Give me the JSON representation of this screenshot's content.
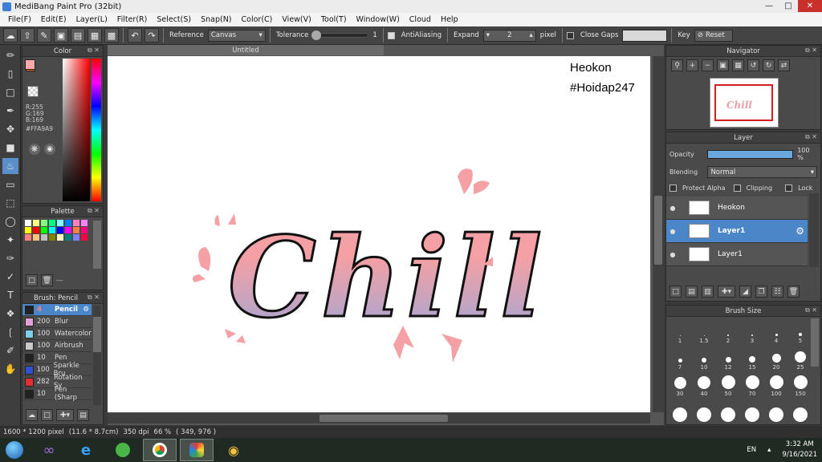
{
  "window": {
    "title": "MediBang Paint Pro (32bit)"
  },
  "menu": [
    "File(F)",
    "Edit(E)",
    "Layer(L)",
    "Filter(R)",
    "Select(S)",
    "Snap(N)",
    "Color(C)",
    "View(V)",
    "Tool(T)",
    "Window(W)",
    "Cloud",
    "Help"
  ],
  "toolbar": {
    "reference_label": "Reference",
    "reference_value": "Canvas",
    "tolerance_label": "Tolerance",
    "tolerance_value": "1",
    "antialiasing_label": "AntiAliasing",
    "expand_label": "Expand",
    "expand_value": "2",
    "expand_unit": "pixel",
    "close_gaps_label": "Close Gaps",
    "key_label": "Key",
    "reset_label": "Reset"
  },
  "color_panel": {
    "title": "Color",
    "r": "R:255",
    "g": "G:169",
    "b": "B:169",
    "hex": "#FFA9A9",
    "primary": "#FFA9A9",
    "secondary": "#FF6A00"
  },
  "palette_panel": {
    "title": "Palette",
    "swatches": [
      "#ffffff",
      "#ffff80",
      "#80ff80",
      "#00ff80",
      "#80ffff",
      "#0080ff",
      "#ff80c0",
      "#ff80ff",
      "#ffff00",
      "#ff0000",
      "#00ff00",
      "#00ffff",
      "#0000ff",
      "#ff00ff",
      "#ff8040",
      "#ff0080",
      "#ff8080",
      "#ffc080",
      "#c0c0c0",
      "#808000",
      "#ffffc0",
      "#008080",
      "#8080ff",
      "#ff0040"
    ],
    "dash": "---"
  },
  "brush_panel": {
    "title": "Brush: Pencil",
    "items": [
      {
        "size": "4",
        "name": "Pencil",
        "color": "#222"
      },
      {
        "size": "200",
        "name": "Blur",
        "color": "#e2a0d8"
      },
      {
        "size": "100",
        "name": "Watercolor",
        "color": "#7cd0e8"
      },
      {
        "size": "100",
        "name": "Airbrush",
        "color": "#c8c8c8"
      },
      {
        "size": "10",
        "name": "Pen",
        "color": "#222"
      },
      {
        "size": "100",
        "name": "Sparkle Bru",
        "color": "#3050d0"
      },
      {
        "size": "282",
        "name": "Rotation Sy",
        "color": "#e03030"
      },
      {
        "size": "10",
        "name": "Pen (Sharp",
        "color": "#222"
      }
    ]
  },
  "canvas": {
    "tab": "Untitled",
    "watermark_line1": "Heokon",
    "watermark_line2": "#Hoidap247",
    "artwork_text": "Chill"
  },
  "navigator": {
    "title": "Navigator"
  },
  "layer_panel": {
    "title": "Layer",
    "opacity_label": "Opacity",
    "opacity_value": "100 %",
    "opacity_fraction": 1.0,
    "blending_label": "Blending",
    "blending_value": "Normal",
    "protect_alpha": "Protect Alpha",
    "clipping": "Clipping",
    "lock": "Lock",
    "layers": [
      {
        "name": "Heokon",
        "selected": false
      },
      {
        "name": "Layer1",
        "selected": true
      },
      {
        "name": "Layer1",
        "selected": false
      }
    ]
  },
  "brush_size_panel": {
    "title": "Brush Size",
    "sizes": [
      "1",
      "1.5",
      "2",
      "3",
      "4",
      "5",
      "7",
      "10",
      "12",
      "15",
      "20",
      "25",
      "30",
      "40",
      "50",
      "70",
      "100",
      "150"
    ]
  },
  "status": {
    "dimensions": "1600 * 1200 pixel",
    "physical": "(11.6 * 8.7cm)",
    "dpi": "350 dpi",
    "zoom": "66 %",
    "coords": "( 349, 976 )"
  },
  "tray": {
    "lang": "EN",
    "time": "3:32 AM",
    "date": "9/16/2021"
  }
}
